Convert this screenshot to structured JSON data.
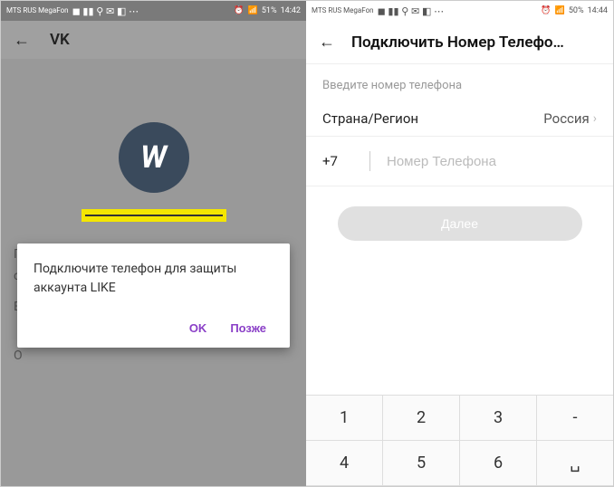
{
  "statusBar": {
    "carrier": "MTS RUS\nMegaFon",
    "icons_left": "◼ ▮▮ ⚲ ✉ ◧ ⋯",
    "signal": "📶",
    "alarm": "⏰",
    "battery_left": "51%",
    "battery_right": "50%",
    "time_left": "14:42",
    "time_right": "14:44"
  },
  "left": {
    "title": "VK",
    "vk_letter": "W",
    "bg_line1": "П",
    "bg_line2": "с",
    "bg_line3": "В",
    "bg_line4": "О",
    "dialog": {
      "message": "Подключите телефон для защиты аккаунта LIKE",
      "ok": "OK",
      "later": "Позже"
    }
  },
  "right": {
    "title": "Подключить Номер Телефо…",
    "hint": "Введите номер телефона",
    "region_label": "Страна/Регион",
    "region_value": "Россия",
    "prefix": "+7",
    "placeholder": "Номер Телефона",
    "next": "Далее",
    "keys_row1": [
      "1",
      "2",
      "3",
      "-"
    ],
    "keys_row2": [
      "4",
      "5",
      "6",
      "␣"
    ]
  }
}
